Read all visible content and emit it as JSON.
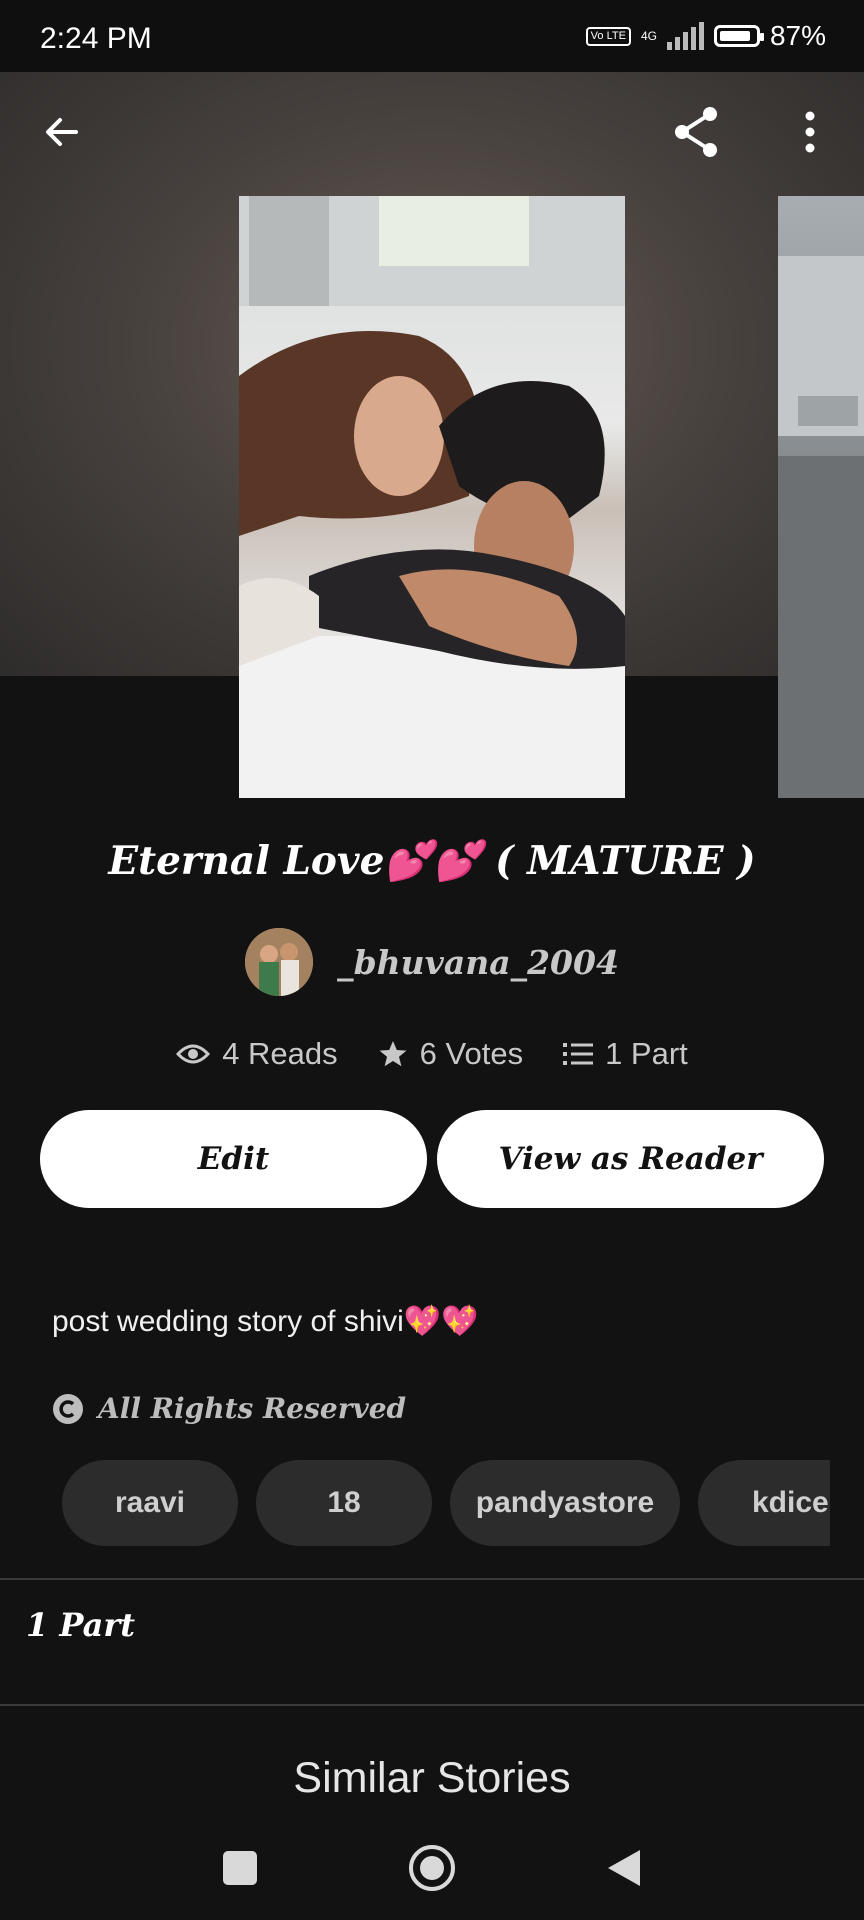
{
  "status_bar": {
    "time": "2:24 PM",
    "volte": "Vo LTE",
    "network": "4G",
    "battery": "87%",
    "battery_level": 0.87
  },
  "header": {
    "back_icon": "arrow-left-icon",
    "share_icon": "share-icon",
    "menu_icon": "more-vertical-icon"
  },
  "story": {
    "title": "Eternal Love💕💕 ( MATURE )",
    "author": "_bhuvana_2004",
    "stats": {
      "reads": "4 Reads",
      "votes": "6 Votes",
      "parts": "1 Part"
    },
    "buttons": {
      "edit": "Edit",
      "view_as_reader": "View as Reader"
    },
    "description": "post wedding story of shivi💖💖",
    "rights": "All Rights Reserved",
    "tags": [
      "raavi",
      "18",
      "pandyastore",
      "kdice"
    ]
  },
  "parts_section": {
    "label": "1 Part"
  },
  "similar_section": {
    "label": "Similar Stories"
  },
  "nav_bar": {
    "recents_icon": "square-icon",
    "home_icon": "circle-home-icon",
    "back_icon": "triangle-back-icon"
  },
  "colors": {
    "background": "#121212",
    "button_bg": "#ffffff",
    "tag_bg": "#2c2c2c",
    "muted_text": "#c8c8c8"
  }
}
